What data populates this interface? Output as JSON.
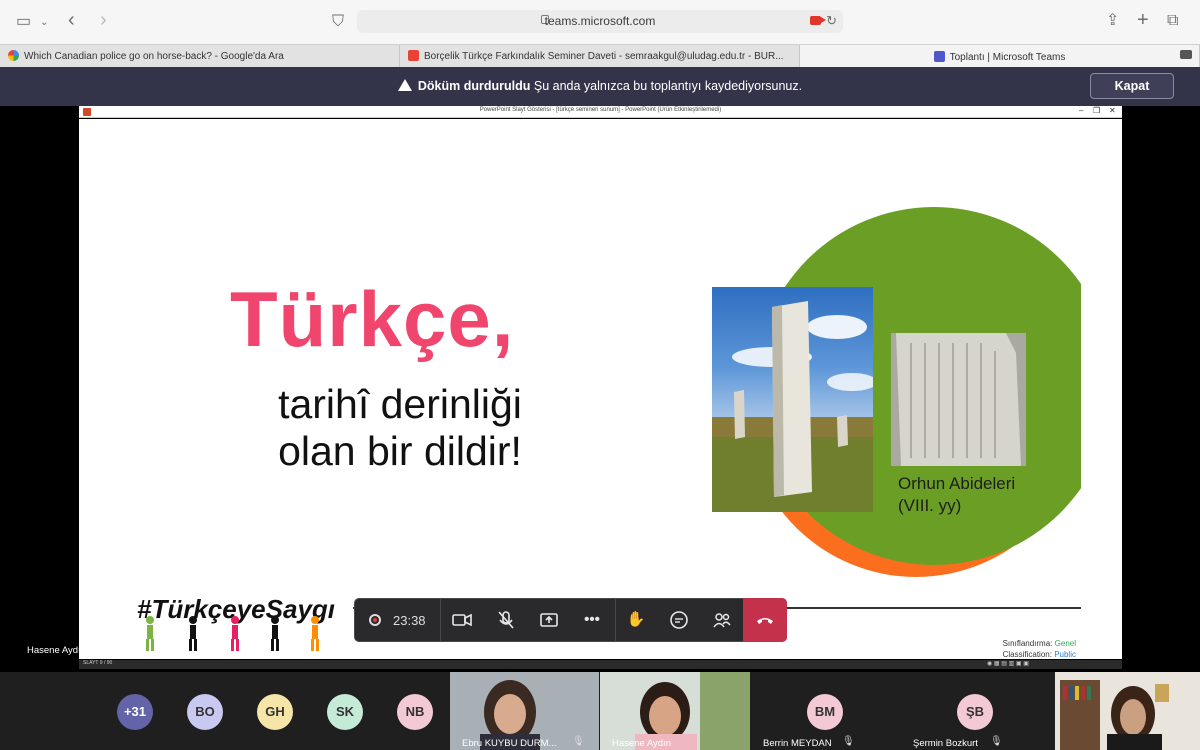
{
  "browser": {
    "url": "teams.microsoft.com",
    "tabs": [
      {
        "label": "Which Canadian police go on horse-back? - Google'da Ara"
      },
      {
        "label": "Borçelik Türkçe Farkındalık Seminer Daveti - semraakgul@uludag.edu.tr - BUR..."
      },
      {
        "label": "Toplantı | Microsoft Teams"
      }
    ]
  },
  "banner": {
    "title": "Döküm durduruldu",
    "message": "Şu anda yalnızca bu toplantıyı kaydediyorsunuz.",
    "close_label": "Kapat"
  },
  "ppt": {
    "window_title": "PowerPoint Slayt Gösterisi - [türkçe semineri sunum] - PowerPoint (Ürün Etkinleştirilemedi)",
    "status": "SLAYT 9 / 90"
  },
  "slide": {
    "headline": "Türkçe,",
    "subtitle_line1": "tarihî derinliği",
    "subtitle_line2": "olan bir dildir!",
    "caption_line1": "Orhun Abideleri",
    "caption_line2": "(VIII. yy)",
    "hashtag": "#TürkçeyeSaygı",
    "classification_label_tr": "Sınıflandırma:",
    "classification_value_tr": "Genel",
    "classification_label_en": "Classification:",
    "classification_value_en": "Public"
  },
  "controls": {
    "timer": "23:38"
  },
  "presenter_name": "Hasene Aydın",
  "participants": {
    "avatars": [
      {
        "initials": "+31",
        "color": "#6264a7"
      },
      {
        "initials": "BO",
        "color": "#c8c8f0"
      },
      {
        "initials": "GH",
        "color": "#f6e5a8"
      },
      {
        "initials": "SK",
        "color": "#c5ead7"
      },
      {
        "initials": "NB",
        "color": "#f4c9d6"
      }
    ],
    "videos": [
      {
        "name": "Ebru KUYBU DURM..."
      },
      {
        "name": "Hasene Aydın"
      }
    ],
    "named_avatars": [
      {
        "initials": "BM",
        "name": "Berrin MEYDAN",
        "color": "#f4c9d6"
      },
      {
        "initials": "ŞB",
        "name": "Şermin Bozkurt",
        "color": "#f4c9d6"
      }
    ]
  }
}
